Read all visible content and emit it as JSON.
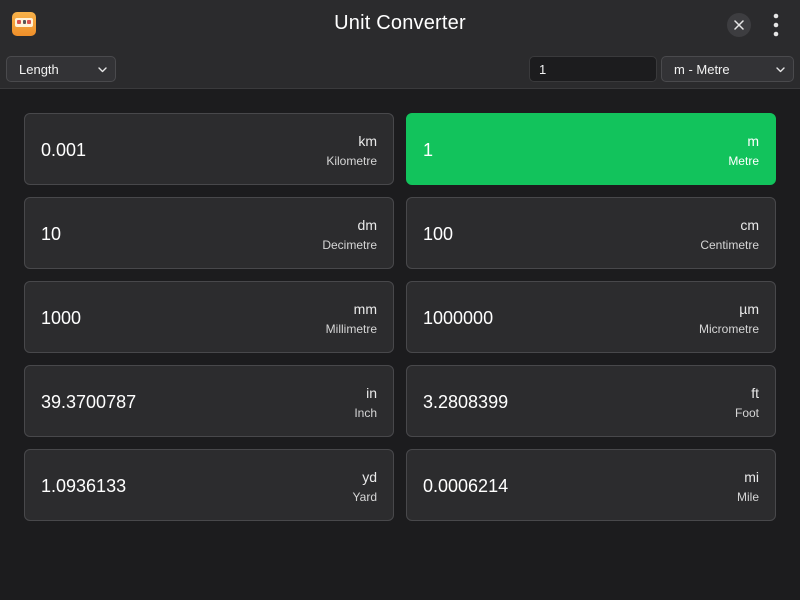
{
  "window": {
    "title": "Unit Converter",
    "app_icon": "unit-converter-app-icon",
    "close_icon": "close-icon",
    "more_icon": "more-vertical-icon"
  },
  "toolbar": {
    "category": "Length",
    "input_value": "1",
    "selected_unit": "m - Metre"
  },
  "colors": {
    "active_card": "#12c35c",
    "card_bg": "#2c2c2e",
    "window_bg": "#1c1c1e"
  },
  "results": [
    {
      "value": "0.001",
      "symbol": "km",
      "name": "Kilometre",
      "active": false
    },
    {
      "value": "1",
      "symbol": "m",
      "name": "Metre",
      "active": true
    },
    {
      "value": "10",
      "symbol": "dm",
      "name": "Decimetre",
      "active": false
    },
    {
      "value": "100",
      "symbol": "cm",
      "name": "Centimetre",
      "active": false
    },
    {
      "value": "1000",
      "symbol": "mm",
      "name": "Millimetre",
      "active": false
    },
    {
      "value": "1000000",
      "symbol": "µm",
      "name": "Micrometre",
      "active": false
    },
    {
      "value": "39.3700787",
      "symbol": "in",
      "name": "Inch",
      "active": false
    },
    {
      "value": "3.2808399",
      "symbol": "ft",
      "name": "Foot",
      "active": false
    },
    {
      "value": "1.0936133",
      "symbol": "yd",
      "name": "Yard",
      "active": false
    },
    {
      "value": "0.0006214",
      "symbol": "mi",
      "name": "Mile",
      "active": false
    }
  ]
}
